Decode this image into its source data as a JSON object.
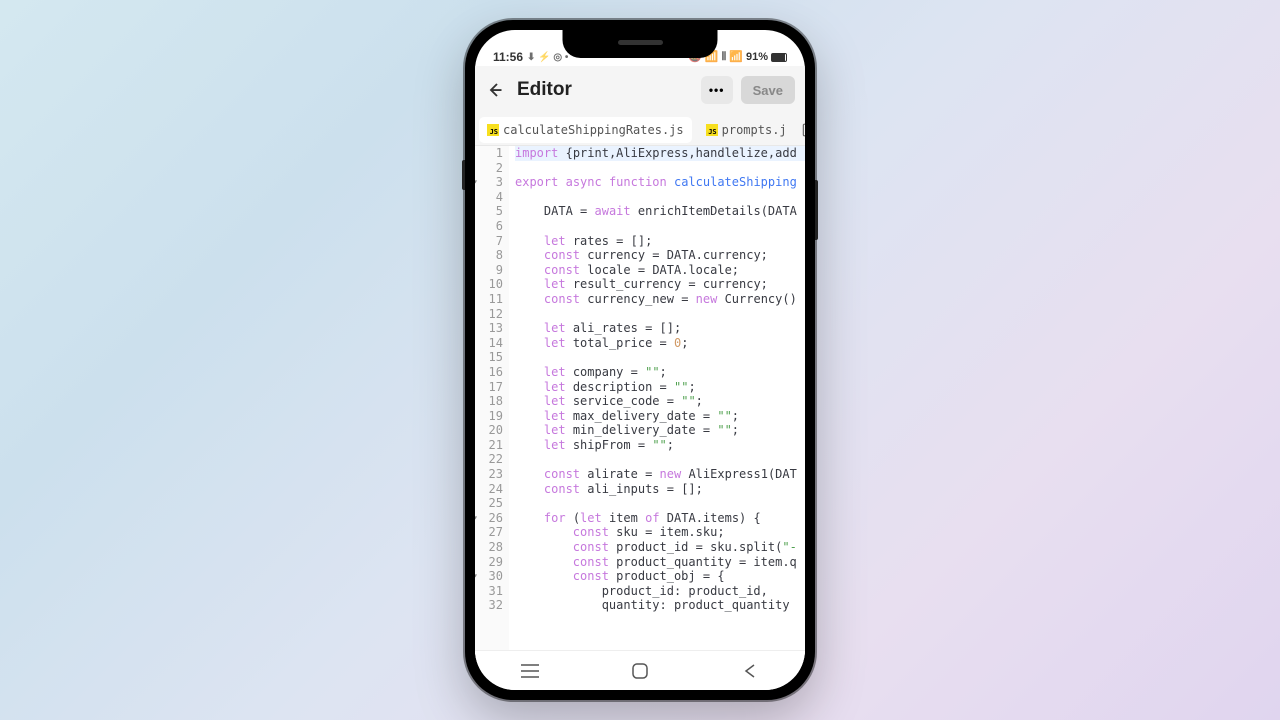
{
  "status": {
    "time": "11:56",
    "icons_left": "⬇ ⚡ ◎ •",
    "icons_right": "🔕 📶 ⫴ 📶",
    "battery": "91%"
  },
  "header": {
    "title": "Editor",
    "more": "•••",
    "save": "Save"
  },
  "tabs": [
    {
      "label": "calculateShippingRates.js",
      "active": true
    },
    {
      "label": "prompts.j",
      "active": false
    }
  ],
  "code": {
    "lines": [
      {
        "n": 1,
        "fold": false,
        "hl": true,
        "tokens": [
          [
            "kw",
            "import"
          ],
          [
            "op",
            " {"
          ],
          [
            "id",
            "print"
          ],
          [
            "op",
            ","
          ],
          [
            "id",
            "AliExpress"
          ],
          [
            "op",
            ","
          ],
          [
            "id",
            "handlelize"
          ],
          [
            "op",
            ","
          ],
          [
            "id",
            "add"
          ]
        ]
      },
      {
        "n": 2,
        "fold": false,
        "hl": false,
        "tokens": []
      },
      {
        "n": 3,
        "fold": true,
        "hl": false,
        "tokens": [
          [
            "kw",
            "export"
          ],
          [
            "op",
            " "
          ],
          [
            "kw",
            "async"
          ],
          [
            "op",
            " "
          ],
          [
            "kw",
            "function"
          ],
          [
            "op",
            " "
          ],
          [
            "fn",
            "calculateShipping"
          ]
        ]
      },
      {
        "n": 4,
        "fold": false,
        "hl": false,
        "tokens": []
      },
      {
        "n": 5,
        "fold": false,
        "hl": false,
        "tokens": [
          [
            "op",
            "    "
          ],
          [
            "id",
            "DATA"
          ],
          [
            "op",
            " = "
          ],
          [
            "kw",
            "await"
          ],
          [
            "op",
            " "
          ],
          [
            "id",
            "enrichItemDetails"
          ],
          [
            "op",
            "("
          ],
          [
            "id",
            "DATA"
          ]
        ]
      },
      {
        "n": 6,
        "fold": false,
        "hl": false,
        "tokens": []
      },
      {
        "n": 7,
        "fold": false,
        "hl": false,
        "tokens": [
          [
            "op",
            "    "
          ],
          [
            "kw",
            "let"
          ],
          [
            "op",
            " "
          ],
          [
            "id",
            "rates"
          ],
          [
            "op",
            " = [];"
          ]
        ]
      },
      {
        "n": 8,
        "fold": false,
        "hl": false,
        "tokens": [
          [
            "op",
            "    "
          ],
          [
            "kw",
            "const"
          ],
          [
            "op",
            " "
          ],
          [
            "id",
            "currency"
          ],
          [
            "op",
            " = "
          ],
          [
            "id",
            "DATA"
          ],
          [
            "op",
            ".currency;"
          ]
        ]
      },
      {
        "n": 9,
        "fold": false,
        "hl": false,
        "tokens": [
          [
            "op",
            "    "
          ],
          [
            "kw",
            "const"
          ],
          [
            "op",
            " "
          ],
          [
            "id",
            "locale"
          ],
          [
            "op",
            " = "
          ],
          [
            "id",
            "DATA"
          ],
          [
            "op",
            ".locale;"
          ]
        ]
      },
      {
        "n": 10,
        "fold": false,
        "hl": false,
        "tokens": [
          [
            "op",
            "    "
          ],
          [
            "kw",
            "let"
          ],
          [
            "op",
            " "
          ],
          [
            "id",
            "result_currency"
          ],
          [
            "op",
            " = currency;"
          ]
        ]
      },
      {
        "n": 11,
        "fold": false,
        "hl": false,
        "tokens": [
          [
            "op",
            "    "
          ],
          [
            "kw",
            "const"
          ],
          [
            "op",
            " "
          ],
          [
            "id",
            "currency_new"
          ],
          [
            "op",
            " = "
          ],
          [
            "kw",
            "new"
          ],
          [
            "op",
            " "
          ],
          [
            "id",
            "Currency"
          ],
          [
            "op",
            "()"
          ]
        ]
      },
      {
        "n": 12,
        "fold": false,
        "hl": false,
        "tokens": []
      },
      {
        "n": 13,
        "fold": false,
        "hl": false,
        "tokens": [
          [
            "op",
            "    "
          ],
          [
            "kw",
            "let"
          ],
          [
            "op",
            " "
          ],
          [
            "id",
            "ali_rates"
          ],
          [
            "op",
            " = [];"
          ]
        ]
      },
      {
        "n": 14,
        "fold": false,
        "hl": false,
        "tokens": [
          [
            "op",
            "    "
          ],
          [
            "kw",
            "let"
          ],
          [
            "op",
            " "
          ],
          [
            "id",
            "total_price"
          ],
          [
            "op",
            " = "
          ],
          [
            "num",
            "0"
          ],
          [
            "op",
            ";"
          ]
        ]
      },
      {
        "n": 15,
        "fold": false,
        "hl": false,
        "tokens": []
      },
      {
        "n": 16,
        "fold": false,
        "hl": false,
        "tokens": [
          [
            "op",
            "    "
          ],
          [
            "kw",
            "let"
          ],
          [
            "op",
            " "
          ],
          [
            "id",
            "company"
          ],
          [
            "op",
            " = "
          ],
          [
            "str",
            "\"\""
          ],
          [
            "op",
            ";"
          ]
        ]
      },
      {
        "n": 17,
        "fold": false,
        "hl": false,
        "tokens": [
          [
            "op",
            "    "
          ],
          [
            "kw",
            "let"
          ],
          [
            "op",
            " "
          ],
          [
            "id",
            "description"
          ],
          [
            "op",
            " = "
          ],
          [
            "str",
            "\"\""
          ],
          [
            "op",
            ";"
          ]
        ]
      },
      {
        "n": 18,
        "fold": false,
        "hl": false,
        "tokens": [
          [
            "op",
            "    "
          ],
          [
            "kw",
            "let"
          ],
          [
            "op",
            " "
          ],
          [
            "id",
            "service_code"
          ],
          [
            "op",
            " = "
          ],
          [
            "str",
            "\"\""
          ],
          [
            "op",
            ";"
          ]
        ]
      },
      {
        "n": 19,
        "fold": false,
        "hl": false,
        "tokens": [
          [
            "op",
            "    "
          ],
          [
            "kw",
            "let"
          ],
          [
            "op",
            " "
          ],
          [
            "id",
            "max_delivery_date"
          ],
          [
            "op",
            " = "
          ],
          [
            "str",
            "\"\""
          ],
          [
            "op",
            ";"
          ]
        ]
      },
      {
        "n": 20,
        "fold": false,
        "hl": false,
        "tokens": [
          [
            "op",
            "    "
          ],
          [
            "kw",
            "let"
          ],
          [
            "op",
            " "
          ],
          [
            "id",
            "min_delivery_date"
          ],
          [
            "op",
            " = "
          ],
          [
            "str",
            "\"\""
          ],
          [
            "op",
            ";"
          ]
        ]
      },
      {
        "n": 21,
        "fold": false,
        "hl": false,
        "tokens": [
          [
            "op",
            "    "
          ],
          [
            "kw",
            "let"
          ],
          [
            "op",
            " "
          ],
          [
            "id",
            "shipFrom"
          ],
          [
            "op",
            " = "
          ],
          [
            "str",
            "\"\""
          ],
          [
            "op",
            ";"
          ]
        ]
      },
      {
        "n": 22,
        "fold": false,
        "hl": false,
        "tokens": []
      },
      {
        "n": 23,
        "fold": false,
        "hl": false,
        "tokens": [
          [
            "op",
            "    "
          ],
          [
            "kw",
            "const"
          ],
          [
            "op",
            " "
          ],
          [
            "id",
            "alirate"
          ],
          [
            "op",
            " = "
          ],
          [
            "kw",
            "new"
          ],
          [
            "op",
            " "
          ],
          [
            "id",
            "AliExpress1"
          ],
          [
            "op",
            "("
          ],
          [
            "id",
            "DAT"
          ]
        ]
      },
      {
        "n": 24,
        "fold": false,
        "hl": false,
        "tokens": [
          [
            "op",
            "    "
          ],
          [
            "kw",
            "const"
          ],
          [
            "op",
            " "
          ],
          [
            "id",
            "ali_inputs"
          ],
          [
            "op",
            " = [];"
          ]
        ]
      },
      {
        "n": 25,
        "fold": false,
        "hl": false,
        "tokens": []
      },
      {
        "n": 26,
        "fold": true,
        "hl": false,
        "tokens": [
          [
            "op",
            "    "
          ],
          [
            "kw",
            "for"
          ],
          [
            "op",
            " ("
          ],
          [
            "kw",
            "let"
          ],
          [
            "op",
            " "
          ],
          [
            "id",
            "item"
          ],
          [
            "op",
            " "
          ],
          [
            "kw",
            "of"
          ],
          [
            "op",
            " "
          ],
          [
            "id",
            "DATA"
          ],
          [
            "op",
            ".items) {"
          ]
        ]
      },
      {
        "n": 27,
        "fold": false,
        "hl": false,
        "tokens": [
          [
            "op",
            "        "
          ],
          [
            "kw",
            "const"
          ],
          [
            "op",
            " "
          ],
          [
            "id",
            "sku"
          ],
          [
            "op",
            " = item.sku;"
          ]
        ]
      },
      {
        "n": 28,
        "fold": false,
        "hl": false,
        "tokens": [
          [
            "op",
            "        "
          ],
          [
            "kw",
            "const"
          ],
          [
            "op",
            " "
          ],
          [
            "id",
            "product_id"
          ],
          [
            "op",
            " = sku."
          ],
          [
            "id",
            "split"
          ],
          [
            "op",
            "("
          ],
          [
            "str",
            "\"-"
          ]
        ]
      },
      {
        "n": 29,
        "fold": false,
        "hl": false,
        "tokens": [
          [
            "op",
            "        "
          ],
          [
            "kw",
            "const"
          ],
          [
            "op",
            " "
          ],
          [
            "id",
            "product_quantity"
          ],
          [
            "op",
            " = item.q"
          ]
        ]
      },
      {
        "n": 30,
        "fold": true,
        "hl": false,
        "tokens": [
          [
            "op",
            "        "
          ],
          [
            "kw",
            "const"
          ],
          [
            "op",
            " "
          ],
          [
            "id",
            "product_obj"
          ],
          [
            "op",
            " = {"
          ]
        ]
      },
      {
        "n": 31,
        "fold": false,
        "hl": false,
        "tokens": [
          [
            "op",
            "            "
          ],
          [
            "id",
            "product_id"
          ],
          [
            "op",
            ": product_id,"
          ]
        ]
      },
      {
        "n": 32,
        "fold": false,
        "hl": false,
        "tokens": [
          [
            "op",
            "            "
          ],
          [
            "id",
            "quantity"
          ],
          [
            "op",
            ": product_quantity"
          ]
        ]
      }
    ]
  }
}
